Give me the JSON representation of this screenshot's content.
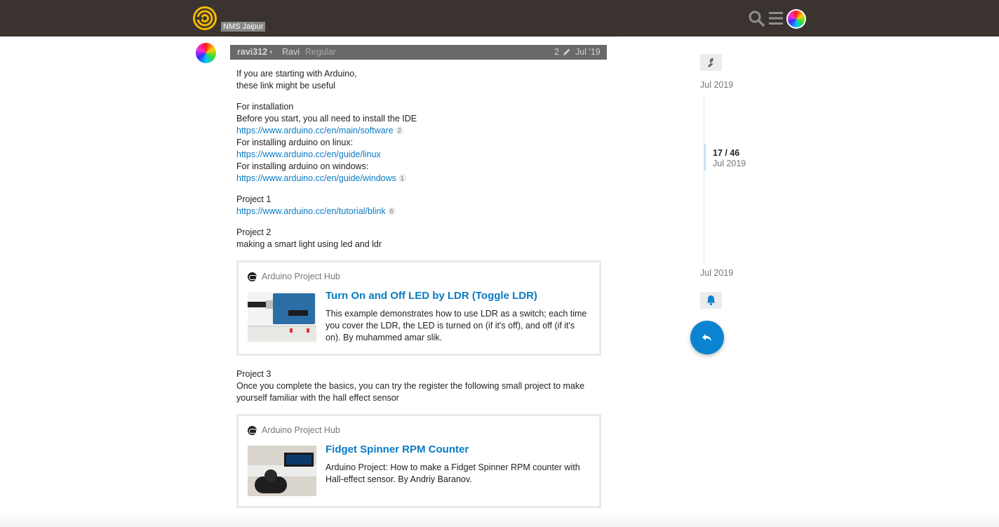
{
  "header": {
    "site_name": "NMS Jaipur",
    "icons": [
      "logo-icon",
      "search-icon",
      "hamburger-menu-icon",
      "user-avatar"
    ]
  },
  "post": {
    "username": "ravi312",
    "full_name": "Ravi",
    "user_title": "Regular",
    "edit_count": "2",
    "date": "Jul '19",
    "intro": [
      "If you are starting with Arduino,",
      "these link might be useful"
    ],
    "installation": {
      "heading": "For installation",
      "line": "Before you start, you all need to install the IDE",
      "link1": "https://www.arduino.cc/en/main/software",
      "link1_clicks": "2",
      "linux_label": "For installing arduino on linux:",
      "link2": "https://www.arduino.cc/en/guide/linux",
      "windows_label": "For installing arduino on windows:",
      "link3": "https://www.arduino.cc/en/guide/windows",
      "link3_clicks": "1"
    },
    "project1": {
      "heading": "Project 1",
      "link": "https://www.arduino.cc/en/tutorial/blink",
      "clicks": "6"
    },
    "project2": {
      "heading": "Project 2",
      "line": "making a smart light using led and ldr"
    },
    "onebox1": {
      "source": "Arduino Project Hub",
      "title": "Turn On and Off LED by LDR (Toggle LDR)",
      "description": "This example demonstrates how to use LDR as a switch; each time you cover the LDR, the LED is turned on (if it's off), and off (if it's on). By muhammed amar slik."
    },
    "project3": {
      "heading": "Project 3",
      "line": "Once you complete the basics, you can try the register the following small project to make yourself familiar with the hall effect sensor"
    },
    "onebox2": {
      "source": "Arduino Project Hub",
      "title": "Fidget Spinner RPM Counter",
      "description": "Arduino Project: How to make a Fidget Spinner RPM counter with Hall-effect sensor. By Andriy Baranov."
    }
  },
  "timeline": {
    "top_date": "Jul 2019",
    "position": "17 / 46",
    "position_date": "Jul 2019",
    "bottom_date": "Jul 2019"
  },
  "colors": {
    "header_bg": "#3a3330",
    "link": "#0a7bc4",
    "logo_yellow": "#f5b800",
    "reply_button": "#0a84d0"
  }
}
